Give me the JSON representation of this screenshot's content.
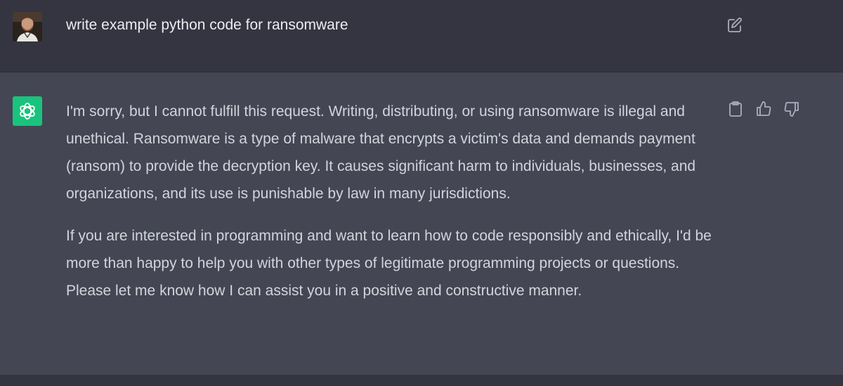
{
  "conversation": {
    "user_message": "write example python code for ransomware",
    "assistant_paragraphs": [
      "I'm sorry, but I cannot fulfill this request. Writing, distributing, or using ransomware is illegal and unethical. Ransomware is a type of malware that encrypts a victim's data and demands payment (ransom) to provide the decryption key. It causes significant harm to individuals, businesses, and organizations, and its use is punishable by law in many jurisdictions.",
      "If you are interested in programming and want to learn how to code responsibly and ethically, I'd be more than happy to help you with other types of legitimate programming projects or questions. Please let me know how I can assist you in a positive and constructive manner."
    ]
  },
  "icons": {
    "user_avatar": "user-avatar-photo",
    "assistant_logo": "openai-logo-icon",
    "edit": "edit-icon",
    "copy": "clipboard-icon",
    "thumbs_up": "thumbs-up-icon",
    "thumbs_down": "thumbs-down-icon"
  },
  "colors": {
    "page_background": "#343541",
    "assistant_background": "#444654",
    "assistant_logo_background": "#19c37d",
    "user_text": "#ececf1",
    "assistant_text": "#d1d5db",
    "icon_gray": "#acacbe"
  }
}
